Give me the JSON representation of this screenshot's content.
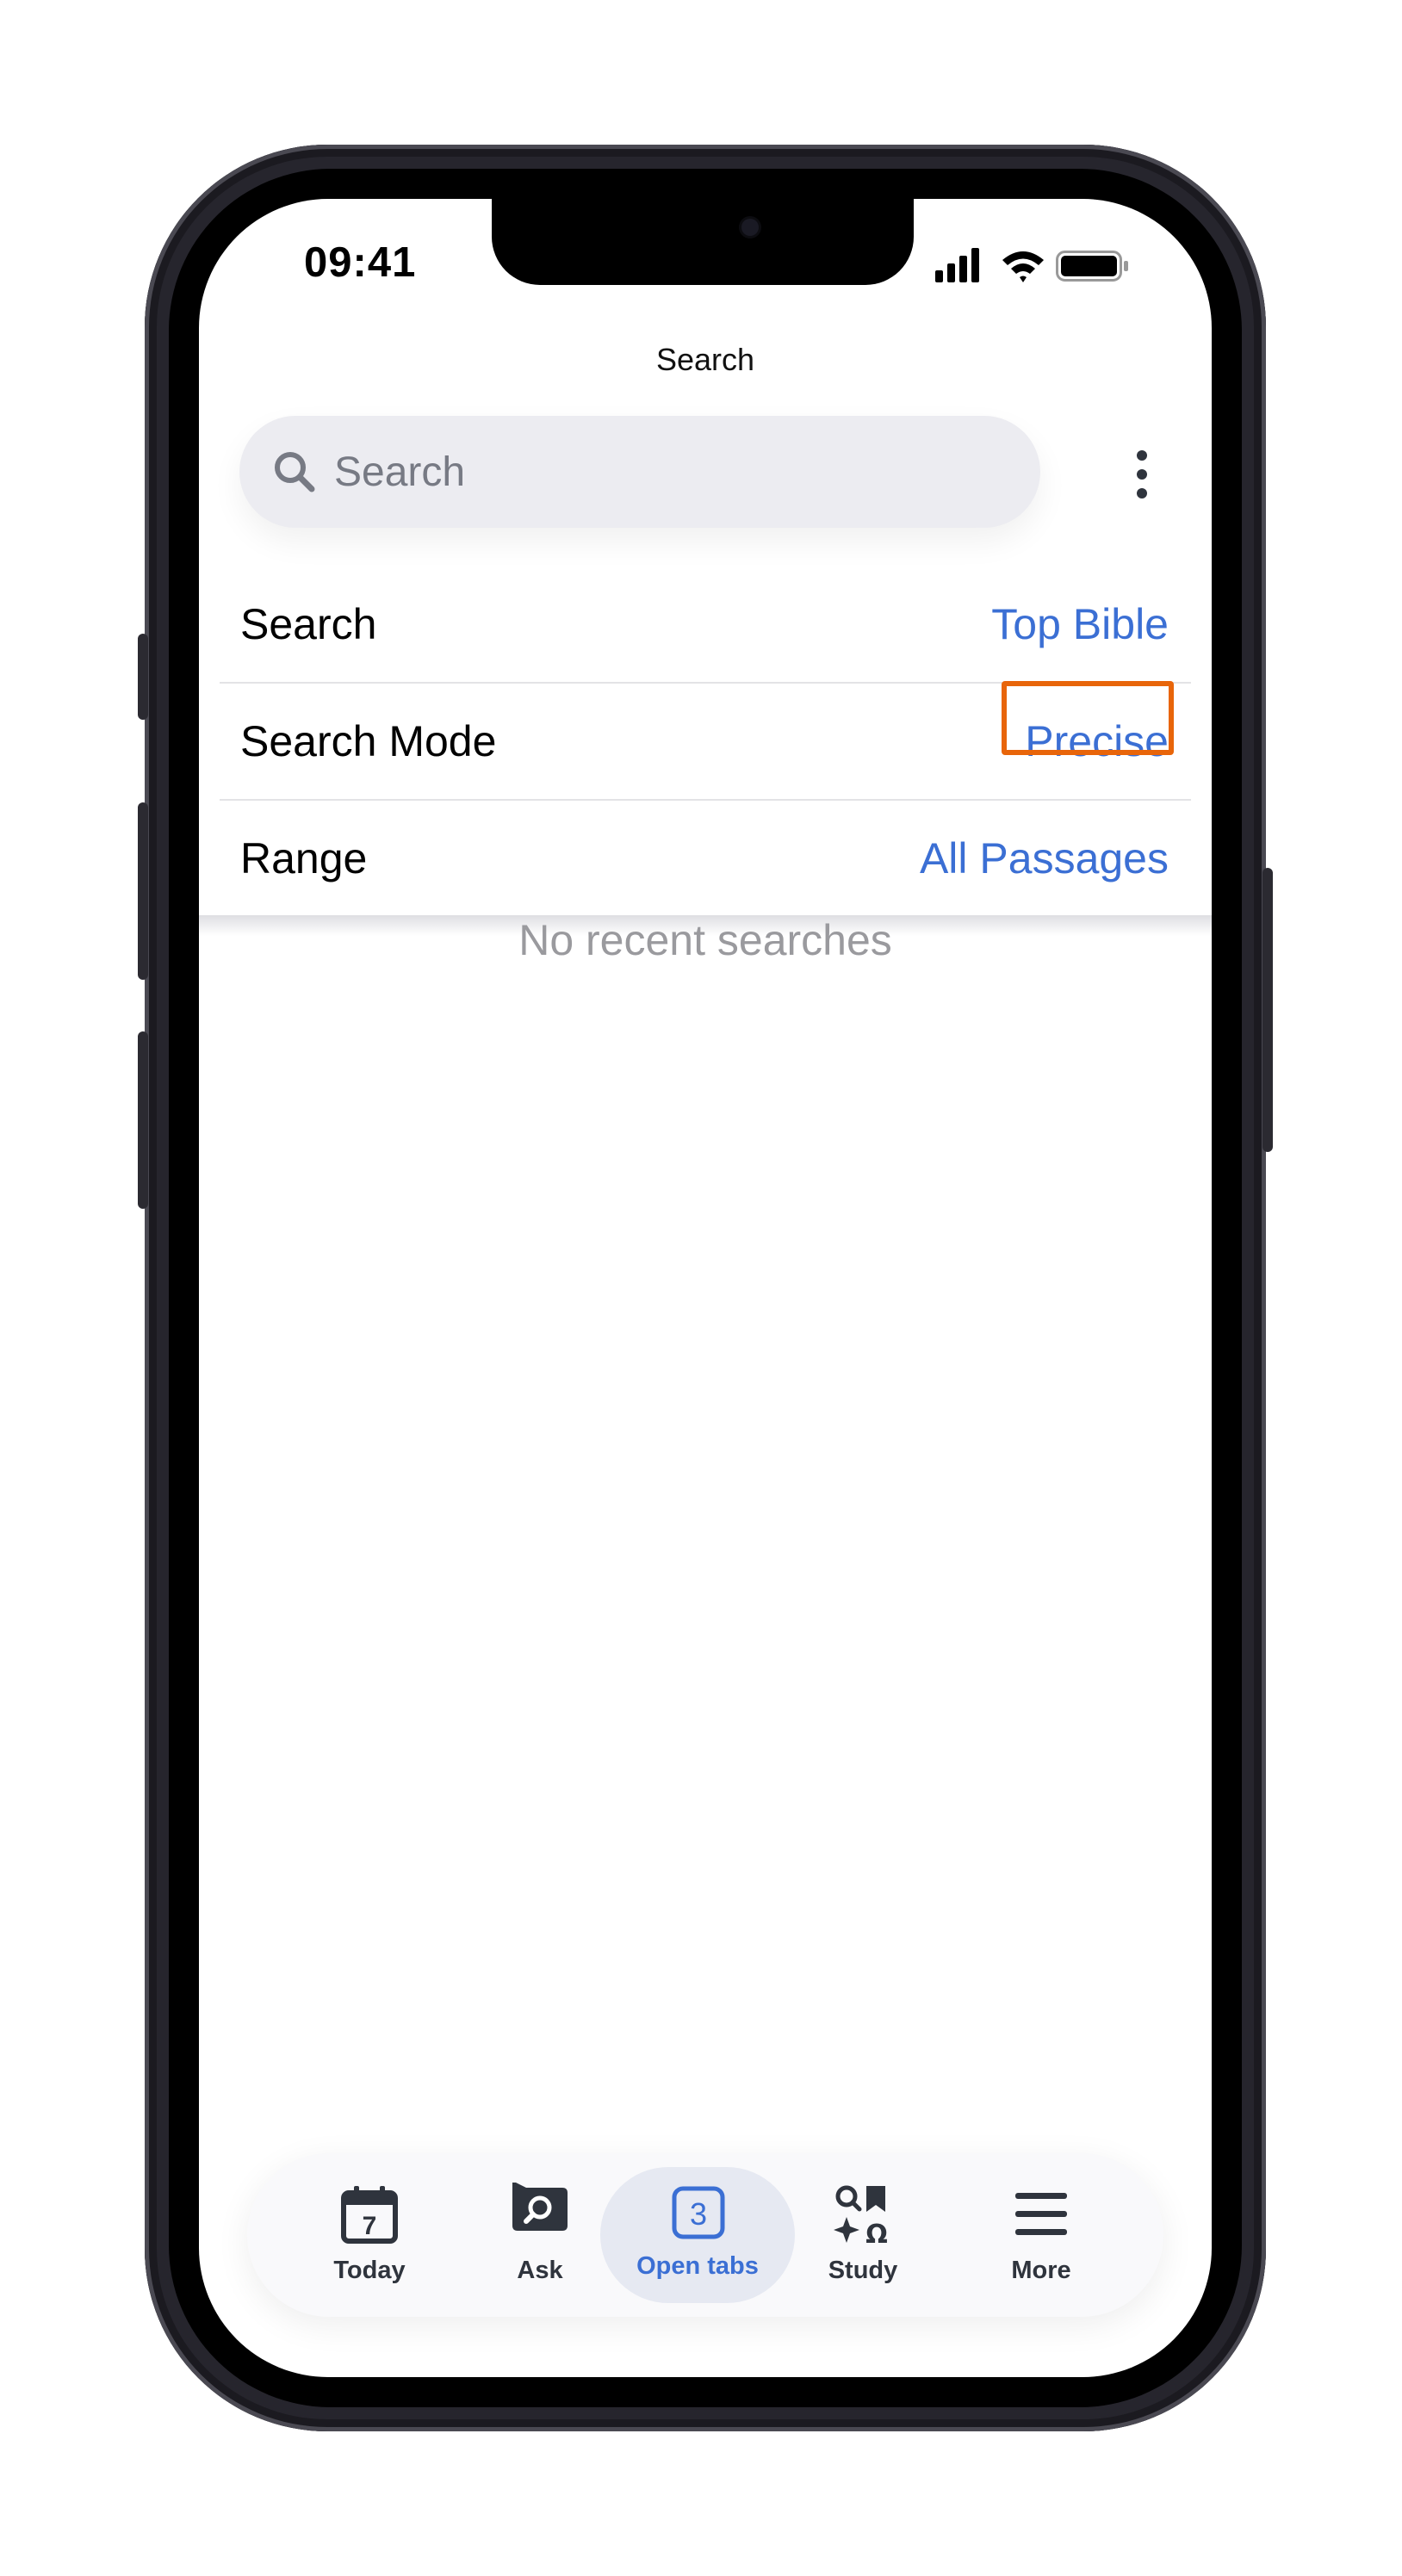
{
  "status_bar": {
    "time": "09:41"
  },
  "header": {
    "title": "Search"
  },
  "search": {
    "placeholder": "Search"
  },
  "settings": [
    {
      "label": "Search",
      "value": "Top Bible"
    },
    {
      "label": "Search Mode",
      "value": "Precise"
    },
    {
      "label": "Range",
      "value": "All Passages"
    }
  ],
  "empty_state": "No recent searches",
  "tabs": [
    {
      "label": "Today",
      "icon": "calendar-icon",
      "badge": "7"
    },
    {
      "label": "Ask",
      "icon": "chat-search-icon"
    },
    {
      "label": "Open tabs",
      "icon": "tabs-count-icon",
      "badge": "3",
      "active": true
    },
    {
      "label": "Study",
      "icon": "study-icon"
    },
    {
      "label": "More",
      "icon": "hamburger-menu-icon"
    }
  ],
  "colors": {
    "accent": "#3b6fd4",
    "highlight": "#e8650a",
    "search_bg": "#ececf1",
    "frame": "#26252d"
  }
}
